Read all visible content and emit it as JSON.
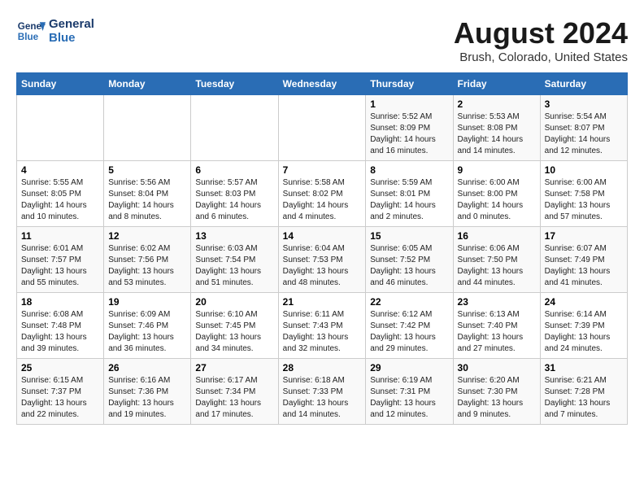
{
  "logo": {
    "line1": "General",
    "line2": "Blue"
  },
  "title": "August 2024",
  "subtitle": "Brush, Colorado, United States",
  "days_of_week": [
    "Sunday",
    "Monday",
    "Tuesday",
    "Wednesday",
    "Thursday",
    "Friday",
    "Saturday"
  ],
  "weeks": [
    [
      {
        "day": "",
        "info": ""
      },
      {
        "day": "",
        "info": ""
      },
      {
        "day": "",
        "info": ""
      },
      {
        "day": "",
        "info": ""
      },
      {
        "day": "1",
        "info": "Sunrise: 5:52 AM\nSunset: 8:09 PM\nDaylight: 14 hours\nand 16 minutes."
      },
      {
        "day": "2",
        "info": "Sunrise: 5:53 AM\nSunset: 8:08 PM\nDaylight: 14 hours\nand 14 minutes."
      },
      {
        "day": "3",
        "info": "Sunrise: 5:54 AM\nSunset: 8:07 PM\nDaylight: 14 hours\nand 12 minutes."
      }
    ],
    [
      {
        "day": "4",
        "info": "Sunrise: 5:55 AM\nSunset: 8:05 PM\nDaylight: 14 hours\nand 10 minutes."
      },
      {
        "day": "5",
        "info": "Sunrise: 5:56 AM\nSunset: 8:04 PM\nDaylight: 14 hours\nand 8 minutes."
      },
      {
        "day": "6",
        "info": "Sunrise: 5:57 AM\nSunset: 8:03 PM\nDaylight: 14 hours\nand 6 minutes."
      },
      {
        "day": "7",
        "info": "Sunrise: 5:58 AM\nSunset: 8:02 PM\nDaylight: 14 hours\nand 4 minutes."
      },
      {
        "day": "8",
        "info": "Sunrise: 5:59 AM\nSunset: 8:01 PM\nDaylight: 14 hours\nand 2 minutes."
      },
      {
        "day": "9",
        "info": "Sunrise: 6:00 AM\nSunset: 8:00 PM\nDaylight: 14 hours\nand 0 minutes."
      },
      {
        "day": "10",
        "info": "Sunrise: 6:00 AM\nSunset: 7:58 PM\nDaylight: 13 hours\nand 57 minutes."
      }
    ],
    [
      {
        "day": "11",
        "info": "Sunrise: 6:01 AM\nSunset: 7:57 PM\nDaylight: 13 hours\nand 55 minutes."
      },
      {
        "day": "12",
        "info": "Sunrise: 6:02 AM\nSunset: 7:56 PM\nDaylight: 13 hours\nand 53 minutes."
      },
      {
        "day": "13",
        "info": "Sunrise: 6:03 AM\nSunset: 7:54 PM\nDaylight: 13 hours\nand 51 minutes."
      },
      {
        "day": "14",
        "info": "Sunrise: 6:04 AM\nSunset: 7:53 PM\nDaylight: 13 hours\nand 48 minutes."
      },
      {
        "day": "15",
        "info": "Sunrise: 6:05 AM\nSunset: 7:52 PM\nDaylight: 13 hours\nand 46 minutes."
      },
      {
        "day": "16",
        "info": "Sunrise: 6:06 AM\nSunset: 7:50 PM\nDaylight: 13 hours\nand 44 minutes."
      },
      {
        "day": "17",
        "info": "Sunrise: 6:07 AM\nSunset: 7:49 PM\nDaylight: 13 hours\nand 41 minutes."
      }
    ],
    [
      {
        "day": "18",
        "info": "Sunrise: 6:08 AM\nSunset: 7:48 PM\nDaylight: 13 hours\nand 39 minutes."
      },
      {
        "day": "19",
        "info": "Sunrise: 6:09 AM\nSunset: 7:46 PM\nDaylight: 13 hours\nand 36 minutes."
      },
      {
        "day": "20",
        "info": "Sunrise: 6:10 AM\nSunset: 7:45 PM\nDaylight: 13 hours\nand 34 minutes."
      },
      {
        "day": "21",
        "info": "Sunrise: 6:11 AM\nSunset: 7:43 PM\nDaylight: 13 hours\nand 32 minutes."
      },
      {
        "day": "22",
        "info": "Sunrise: 6:12 AM\nSunset: 7:42 PM\nDaylight: 13 hours\nand 29 minutes."
      },
      {
        "day": "23",
        "info": "Sunrise: 6:13 AM\nSunset: 7:40 PM\nDaylight: 13 hours\nand 27 minutes."
      },
      {
        "day": "24",
        "info": "Sunrise: 6:14 AM\nSunset: 7:39 PM\nDaylight: 13 hours\nand 24 minutes."
      }
    ],
    [
      {
        "day": "25",
        "info": "Sunrise: 6:15 AM\nSunset: 7:37 PM\nDaylight: 13 hours\nand 22 minutes."
      },
      {
        "day": "26",
        "info": "Sunrise: 6:16 AM\nSunset: 7:36 PM\nDaylight: 13 hours\nand 19 minutes."
      },
      {
        "day": "27",
        "info": "Sunrise: 6:17 AM\nSunset: 7:34 PM\nDaylight: 13 hours\nand 17 minutes."
      },
      {
        "day": "28",
        "info": "Sunrise: 6:18 AM\nSunset: 7:33 PM\nDaylight: 13 hours\nand 14 minutes."
      },
      {
        "day": "29",
        "info": "Sunrise: 6:19 AM\nSunset: 7:31 PM\nDaylight: 13 hours\nand 12 minutes."
      },
      {
        "day": "30",
        "info": "Sunrise: 6:20 AM\nSunset: 7:30 PM\nDaylight: 13 hours\nand 9 minutes."
      },
      {
        "day": "31",
        "info": "Sunrise: 6:21 AM\nSunset: 7:28 PM\nDaylight: 13 hours\nand 7 minutes."
      }
    ]
  ]
}
